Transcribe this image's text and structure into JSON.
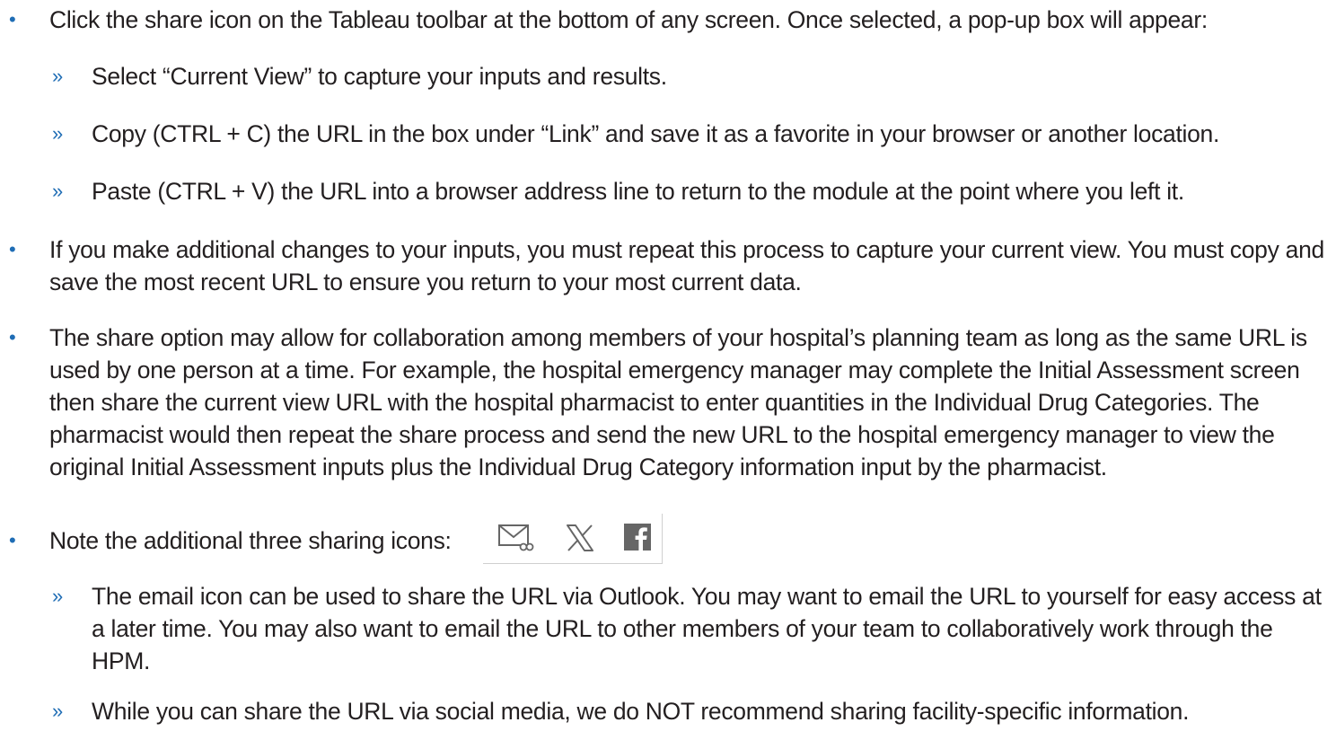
{
  "colors": {
    "bullet": "#1f6db5",
    "text": "#231f20",
    "icon": "#666666"
  },
  "items": [
    {
      "marker": "•",
      "text": "Click the share icon on the Tableau toolbar at the bottom of any screen. Once selected, a pop-up box will appear:"
    },
    {
      "marker": "»",
      "text": "Select “Current View” to capture your inputs and results."
    },
    {
      "marker": "»",
      "text": "Copy (CTRL + C) the URL in the box under “Link” and save it as a favorite in your browser or another location."
    },
    {
      "marker": "»",
      "text": "Paste (CTRL + V) the URL into a browser address line to return to the module at the point where you left it."
    },
    {
      "marker": "•",
      "text": "If you make additional changes to your inputs, you must repeat this process to capture your current view. You must copy and save the most recent URL to ensure you return to your most current data."
    },
    {
      "marker": "•",
      "text": "The share option may allow for collaboration among members of your hospital’s planning team as long as the same URL is used by one person at a time. For example, the hospital emergency manager may complete the Initial Assessment screen then share the current view URL with the hospital pharmacist to enter quantities in the Individual Drug Categories. The pharmacist would then repeat the share process and send the new URL to the hospital emergency manager to view the original Initial Assessment inputs plus the Individual Drug Category information input by the pharmacist."
    },
    {
      "marker": "•",
      "text": "Note the additional three sharing icons:"
    },
    {
      "marker": "»",
      "text": "The email icon can be used to share the URL via Outlook. You may want to email the URL to yourself for easy access at a later time. You may also want to email the URL to other members of your team to collaboratively work through the HPM."
    },
    {
      "marker": "»",
      "text": "While you can share the URL via social media, we do NOT recommend sharing facility-specific information."
    }
  ],
  "sharing_icons": [
    "email-link-icon",
    "x-icon",
    "facebook-icon"
  ]
}
